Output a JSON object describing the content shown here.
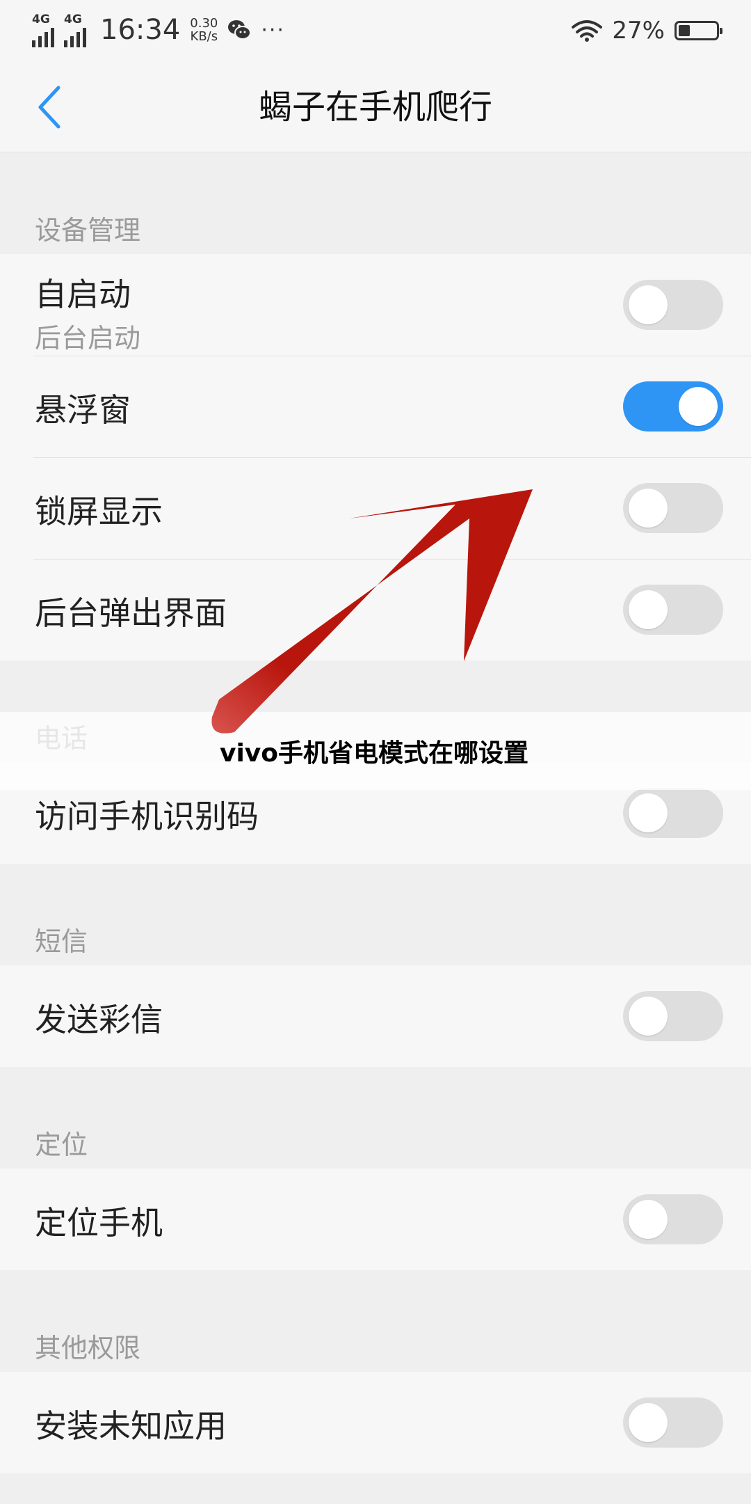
{
  "status_bar": {
    "network_1": "4G",
    "network_2": "4G",
    "time": "16:34",
    "speed_value": "0.30",
    "speed_unit": "KB/s",
    "more": "···",
    "battery_percent": "27%",
    "battery_level": 0.27
  },
  "nav": {
    "title": "蝎子在手机爬行"
  },
  "sections": {
    "device": {
      "header": "设备管理",
      "rows": [
        {
          "label": "自启动",
          "sub": "后台启动",
          "on": false
        },
        {
          "label": "悬浮窗",
          "on": true
        },
        {
          "label": "锁屏显示",
          "on": false
        },
        {
          "label": "后台弹出界面",
          "on": false
        }
      ]
    },
    "phone": {
      "header": "电话",
      "rows": [
        {
          "label": "访问手机识别码",
          "on": false
        }
      ]
    },
    "sms": {
      "header": "短信",
      "rows": [
        {
          "label": "发送彩信",
          "on": false
        }
      ]
    },
    "location": {
      "header": "定位",
      "rows": [
        {
          "label": "定位手机",
          "on": false
        }
      ]
    },
    "other": {
      "header": "其他权限",
      "rows": [
        {
          "label": "安装未知应用",
          "on": false
        }
      ]
    }
  },
  "overlay": {
    "watermark_text": "vivo手机省电模式在哪设置"
  },
  "colors": {
    "accent_blue": "#2e95f5",
    "arrow_red": "#b8160c",
    "toggle_off": "#dedede"
  }
}
